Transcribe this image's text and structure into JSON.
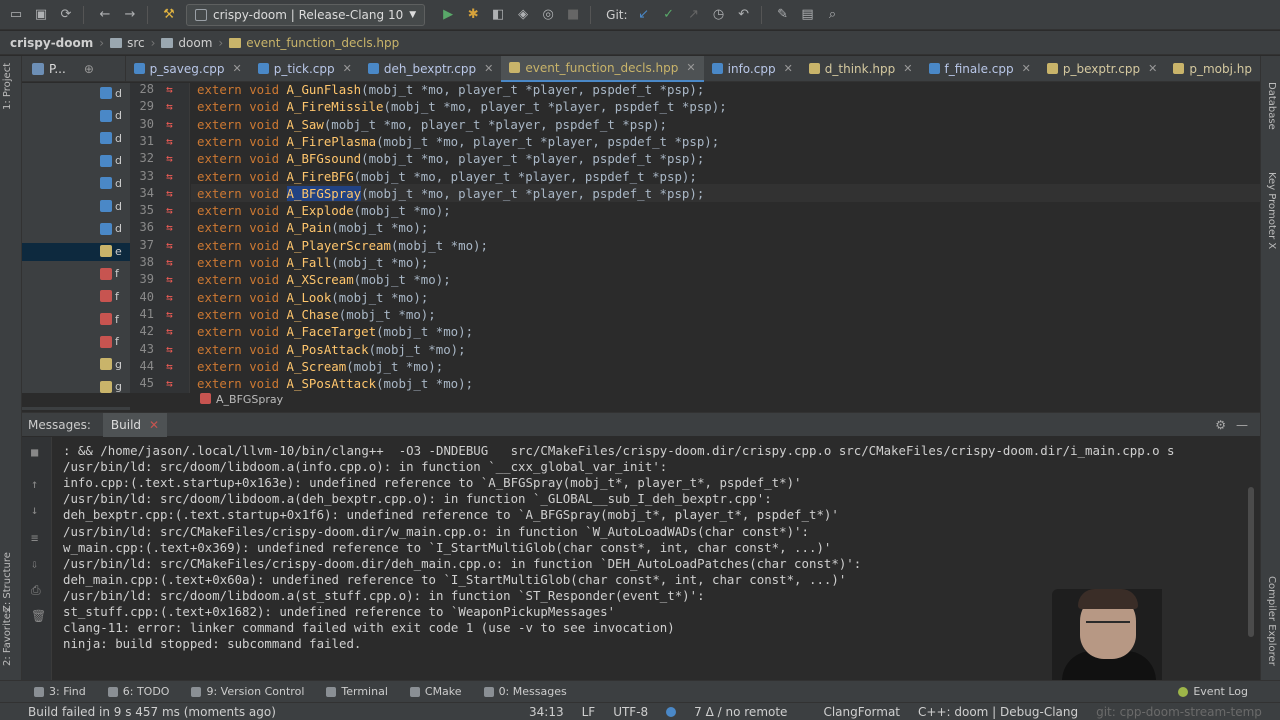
{
  "toolbar": {
    "run_config": "crispy-doom | Release-Clang 10",
    "git_label": "Git:"
  },
  "breadcrumb": {
    "items": [
      "crispy-doom",
      "src",
      "doom",
      "event_function_decls.hpp"
    ]
  },
  "left_stripe": {
    "project": "1: Project",
    "structure": "Z: Structure",
    "favorites": "2: Favorites"
  },
  "right_stripe": {
    "database": "Database",
    "key_promoter": "Key Promoter X",
    "compiler_explorer": "Compiler Explorer"
  },
  "tabs": {
    "project_tab": "P...",
    "files": [
      {
        "label": "p_saveg.cpp",
        "active": false
      },
      {
        "label": "p_tick.cpp",
        "active": false
      },
      {
        "label": "deh_bexptr.cpp",
        "active": false
      },
      {
        "label": "event_function_decls.hpp",
        "active": true
      },
      {
        "label": "info.cpp",
        "active": false
      },
      {
        "label": "d_think.hpp",
        "active": false
      },
      {
        "label": "f_finale.cpp",
        "active": false
      },
      {
        "label": "p_bexptr.cpp",
        "active": false
      },
      {
        "label": "p_mobj.hp",
        "active": false
      }
    ]
  },
  "project_sidebar": {
    "letters": [
      "d",
      "d",
      "d",
      "d",
      "d",
      "d",
      "d",
      "e",
      "f",
      "f",
      "f",
      "f",
      "g",
      "g"
    ]
  },
  "editor": {
    "lines": [
      {
        "num": "28",
        "fn": "A_GunFlash",
        "args": "(mobj_t *mo, player_t *player, pspdef_t *psp);"
      },
      {
        "num": "29",
        "fn": "A_FireMissile",
        "args": "(mobj_t *mo, player_t *player, pspdef_t *psp);"
      },
      {
        "num": "30",
        "fn": "A_Saw",
        "args": "(mobj_t *mo, player_t *player, pspdef_t *psp);"
      },
      {
        "num": "31",
        "fn": "A_FirePlasma",
        "args": "(mobj_t *mo, player_t *player, pspdef_t *psp);"
      },
      {
        "num": "32",
        "fn": "A_BFGsound",
        "args": "(mobj_t *mo, player_t *player, pspdef_t *psp);"
      },
      {
        "num": "33",
        "fn": "A_FireBFG",
        "args": "(mobj_t *mo, player_t *player, pspdef_t *psp);"
      },
      {
        "num": "34",
        "fn": "A_BFGSpray",
        "args": "(mobj_t *mo, player_t *player, pspdef_t *psp);"
      },
      {
        "num": "35",
        "fn": "A_Explode",
        "args": "(mobj_t *mo);"
      },
      {
        "num": "36",
        "fn": "A_Pain",
        "args": "(mobj_t *mo);"
      },
      {
        "num": "37",
        "fn": "A_PlayerScream",
        "args": "(mobj_t *mo);"
      },
      {
        "num": "38",
        "fn": "A_Fall",
        "args": "(mobj_t *mo);"
      },
      {
        "num": "39",
        "fn": "A_XScream",
        "args": "(mobj_t *mo);"
      },
      {
        "num": "40",
        "fn": "A_Look",
        "args": "(mobj_t *mo);"
      },
      {
        "num": "41",
        "fn": "A_Chase",
        "args": "(mobj_t *mo);"
      },
      {
        "num": "42",
        "fn": "A_FaceTarget",
        "args": "(mobj_t *mo);"
      },
      {
        "num": "43",
        "fn": "A_PosAttack",
        "args": "(mobj_t *mo);"
      },
      {
        "num": "44",
        "fn": "A_Scream",
        "args": "(mobj_t *mo);"
      },
      {
        "num": "45",
        "fn": "A_SPosAttack",
        "args": "(mobj_t *mo);"
      }
    ],
    "keyword": "extern void",
    "function_crumb": "A_BFGSpray"
  },
  "build": {
    "header_title": "Messages:",
    "tab_label": "Build",
    "output": [
      ": && /home/jason/.local/llvm-10/bin/clang++  -O3 -DNDEBUG   src/CMakeFiles/crispy-doom.dir/crispy.cpp.o src/CMakeFiles/crispy-doom.dir/i_main.cpp.o s",
      "/usr/bin/ld: src/doom/libdoom.a(info.cpp.o): in function `__cxx_global_var_init':",
      "info.cpp:(.text.startup+0x163e): undefined reference to `A_BFGSpray(mobj_t*, player_t*, pspdef_t*)'",
      "/usr/bin/ld: src/doom/libdoom.a(deh_bexptr.cpp.o): in function `_GLOBAL__sub_I_deh_bexptr.cpp':",
      "deh_bexptr.cpp:(.text.startup+0x1f6): undefined reference to `A_BFGSpray(mobj_t*, player_t*, pspdef_t*)'",
      "/usr/bin/ld: src/CMakeFiles/crispy-doom.dir/w_main.cpp.o: in function `W_AutoLoadWADs(char const*)':",
      "w_main.cpp:(.text+0x369): undefined reference to `I_StartMultiGlob(char const*, int, char const*, ...)'",
      "/usr/bin/ld: src/CMakeFiles/crispy-doom.dir/deh_main.cpp.o: in function `DEH_AutoLoadPatches(char const*)':",
      "deh_main.cpp:(.text+0x60a): undefined reference to `I_StartMultiGlob(char const*, int, char const*, ...)'",
      "/usr/bin/ld: src/doom/libdoom.a(st_stuff.cpp.o): in function `ST_Responder(event_t*)':",
      "st_stuff.cpp:(.text+0x1682): undefined reference to `WeaponPickupMessages'",
      "clang-11: error: linker command failed with exit code 1 (use -v to see invocation)",
      "ninja: build stopped: subcommand failed."
    ]
  },
  "tool_tabs": [
    {
      "label": "3: Find"
    },
    {
      "label": "6: TODO"
    },
    {
      "label": "9: Version Control"
    },
    {
      "label": "Terminal"
    },
    {
      "label": "CMake"
    },
    {
      "label": "0: Messages"
    }
  ],
  "event_log": "Event Log",
  "status": {
    "message": "Build failed in 9 s 457 ms (moments ago)",
    "position": "34:13",
    "line_sep": "LF",
    "encoding": "UTF-8",
    "git": "7 Δ / no remote",
    "formatter": "ClangFormat",
    "context": "C++: doom | Debug-Clang",
    "overlay_text": "git: cpp-doom-stream-temp"
  },
  "colors": {
    "keyword": "#cc7832",
    "function": "#ffc66d",
    "type": "#b5b6e3",
    "param": "#9876aa",
    "error_mark": "#ef5c55",
    "active_tab": "#c9b46a"
  },
  "icons": [
    "save-icon",
    "sync-icon",
    "back-icon",
    "forward-icon",
    "hammer-icon",
    "run-icon",
    "debug-icon",
    "git-update-icon",
    "git-commit-icon",
    "history-icon",
    "revert-icon",
    "settings-icon",
    "search-icon",
    "gear-icon",
    "minimize-icon"
  ]
}
